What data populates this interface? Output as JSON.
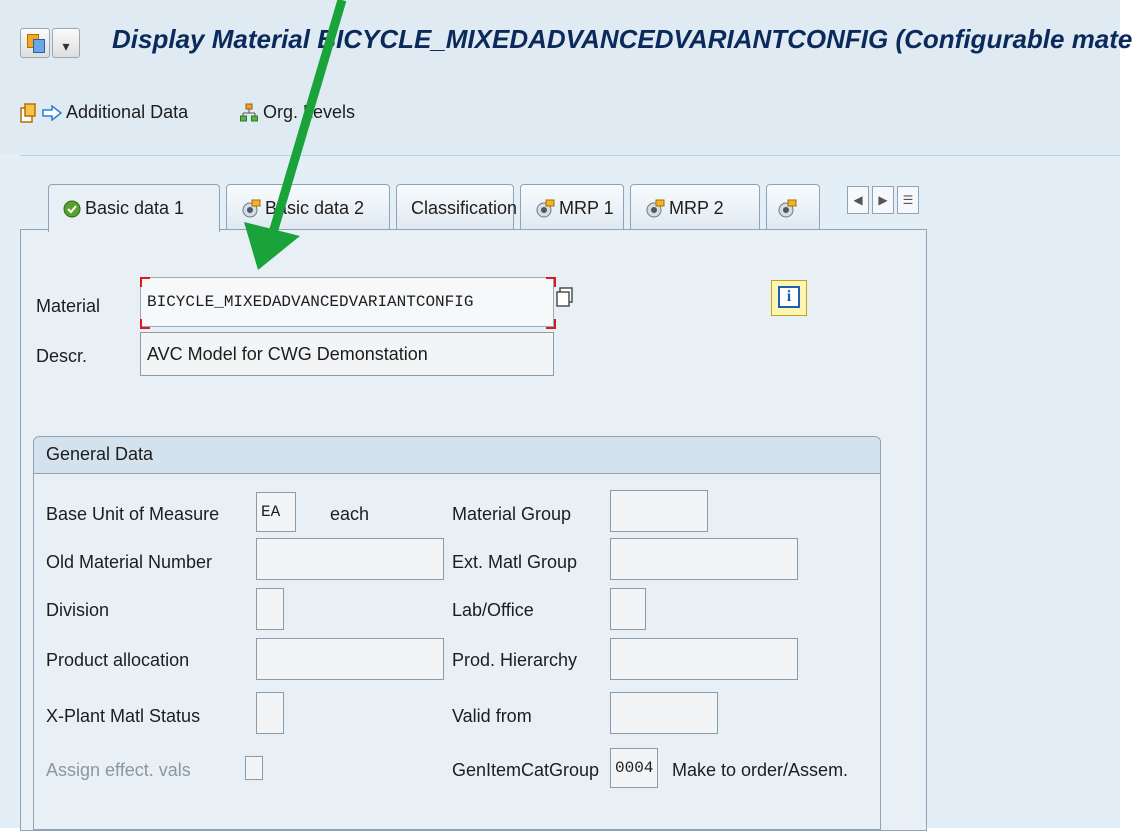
{
  "window": {
    "title": "Display Material BICYCLE_MIXEDADVANCEDVARIANTCONFIG (Configurable mate"
  },
  "toolbar": {
    "additional_data_label": "Additional Data",
    "org_levels_label": "Org. Levels"
  },
  "tabs": [
    {
      "label": "Basic data 1",
      "icon": "check-icon",
      "active": true
    },
    {
      "label": "Basic data 2",
      "icon": "tab-status-icon",
      "active": false
    },
    {
      "label": "Classification",
      "icon": "",
      "active": false
    },
    {
      "label": "MRP 1",
      "icon": "tab-status-icon",
      "active": false
    },
    {
      "label": "MRP 2",
      "icon": "tab-status-icon",
      "active": false
    }
  ],
  "header": {
    "material_label": "Material",
    "material_value": "BICYCLE_MIXEDADVANCEDVARIANTCONFIG",
    "descr_label": "Descr.",
    "descr_value": "AVC Model for CWG Demonstation"
  },
  "general_data": {
    "title": "General Data",
    "base_uom_label": "Base Unit of Measure",
    "base_uom_value": "EA",
    "base_uom_text": "each",
    "material_group_label": "Material Group",
    "material_group_value": "",
    "old_material_number_label": "Old Material Number",
    "old_material_number_value": "",
    "ext_matl_group_label": "Ext. Matl Group",
    "ext_matl_group_value": "",
    "division_label": "Division",
    "division_value": "",
    "lab_office_label": "Lab/Office",
    "lab_office_value": "",
    "product_allocation_label": "Product allocation",
    "product_allocation_value": "",
    "prod_hierarchy_label": "Prod. Hierarchy",
    "prod_hierarchy_value": "",
    "xplant_status_label": "X-Plant Matl Status",
    "xplant_status_value": "",
    "valid_from_label": "Valid from",
    "valid_from_value": "",
    "assign_effect_label": "Assign effect. vals",
    "gen_item_cat_label": "GenItemCatGroup",
    "gen_item_cat_value": "0004",
    "gen_item_cat_text": "Make to order/Assem."
  },
  "colors": {
    "arrow": "#1aa33a",
    "required_corner": "#d81b1b",
    "title_text": "#0b2a5c"
  }
}
